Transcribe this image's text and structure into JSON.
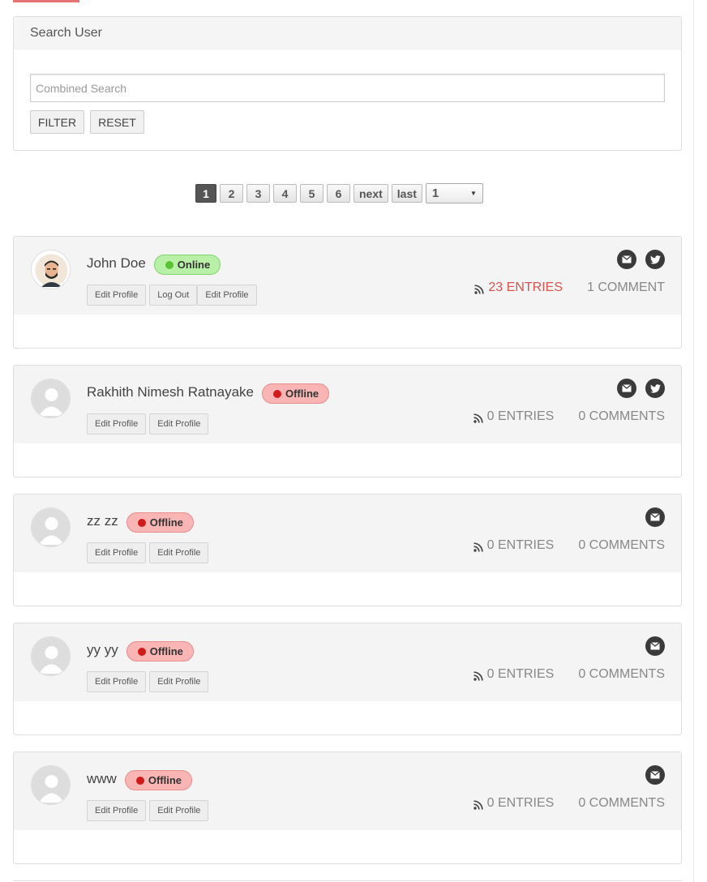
{
  "search": {
    "title": "Search User",
    "placeholder": "Combined Search",
    "value": "",
    "filter_label": "FILTER",
    "reset_label": "RESET"
  },
  "pagination": {
    "current": "1",
    "pages": [
      "2",
      "3",
      "4",
      "5",
      "6"
    ],
    "next_label": "next",
    "last_label": "last",
    "select_value": "1"
  },
  "users": [
    {
      "name": "John Doe",
      "status": "Online",
      "actions": [
        "Edit Profile",
        "Log Out",
        "Edit Profile"
      ],
      "entries": "23 ENTRIES",
      "comments": "1 COMMENT",
      "icons": [
        "envelope-icon",
        "twitter-icon"
      ]
    },
    {
      "name": "Rakhith Nimesh Ratnayake",
      "status": "Offline",
      "actions": [
        "Edit Profile",
        "Edit Profile"
      ],
      "entries": "0 ENTRIES",
      "comments": "0 COMMENTS",
      "icons": [
        "envelope-icon",
        "twitter-icon"
      ]
    },
    {
      "name": "zz zz",
      "status": "Offline",
      "actions": [
        "Edit Profile",
        "Edit Profile"
      ],
      "entries": "0 ENTRIES",
      "comments": "0 COMMENTS",
      "icons": [
        "envelope-icon"
      ]
    },
    {
      "name": "yy yy",
      "status": "Offline",
      "actions": [
        "Edit Profile",
        "Edit Profile"
      ],
      "entries": "0 ENTRIES",
      "comments": "0 COMMENTS",
      "icons": [
        "envelope-icon"
      ]
    },
    {
      "name": "www",
      "status": "Offline",
      "actions": [
        "Edit Profile",
        "Edit Profile"
      ],
      "entries": "0 ENTRIES",
      "comments": "0 COMMENTS",
      "icons": [
        "envelope-icon"
      ]
    }
  ],
  "colors": {
    "accent": "#d9534f",
    "online": "#5bc236",
    "offline": "#d11a1a"
  }
}
